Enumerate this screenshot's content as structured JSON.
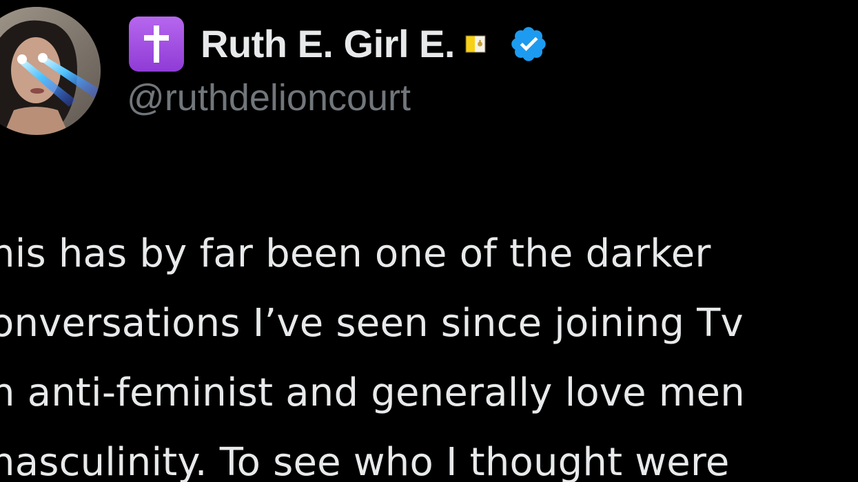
{
  "profile": {
    "display_name": "Ruth E. Girl E.",
    "handle": "@ruthdelioncourt",
    "cross_icon": "latin-cross-emoji",
    "flag_icon": "vatican-flag-emoji",
    "verified_icon": "verified-badge-icon",
    "verified_color": "#1d9bf0"
  },
  "tweet": {
    "lines": [
      "his has by far been one of the darker",
      "onversations I’ve seen since joining Tv",
      "n anti-feminist and generally love men",
      "nasculinity. To see who I thought were"
    ]
  },
  "colors": {
    "background": "#000000",
    "text": "#e7e9ea",
    "secondary_text": "#71767b",
    "cross_box": "#9b4be0"
  }
}
